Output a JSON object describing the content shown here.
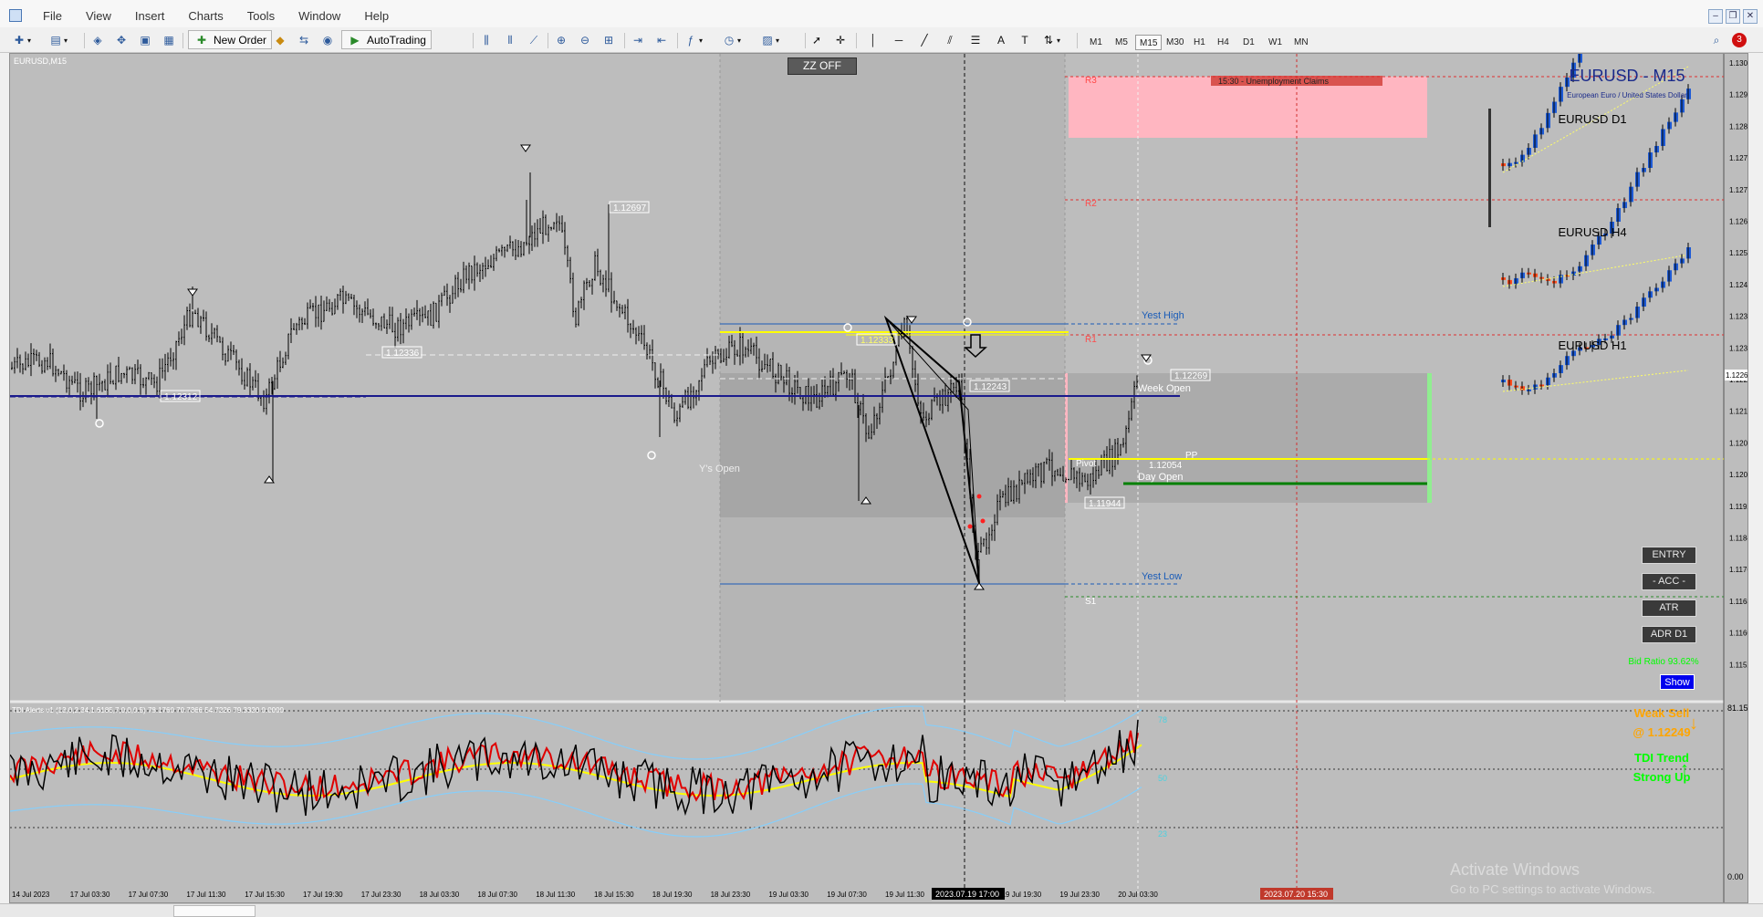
{
  "menu": {
    "items": [
      "File",
      "View",
      "Insert",
      "Charts",
      "Tools",
      "Window",
      "Help"
    ]
  },
  "toolbar": {
    "new_order_label": "New Order",
    "autotrading_label": "AutoTrading",
    "timeframes": [
      "M1",
      "M5",
      "M15",
      "M30",
      "H1",
      "H4",
      "D1",
      "W1",
      "MN"
    ],
    "active_timeframe": "M15",
    "notification_count": "3"
  },
  "chart": {
    "symbol_label": "EURUSD,M15",
    "title": "EURUSD - M15",
    "subtitle": "European Euro / United States Dollar",
    "zz_button": "ZZ OFF",
    "news_label": "15:30 - Unemployment Claims",
    "pivot_labels": {
      "r3": "R3",
      "r2": "R2",
      "r1": "R1",
      "s1": "S1",
      "pp": "PP",
      "pivot": "Pivot"
    },
    "level_labels": {
      "yest_high": "Yest High",
      "yest_low": "Yest Low",
      "week_open": "Week Open",
      "day_open": "Day Open",
      "ys_open": "Y's Open"
    },
    "price_labels": {
      "hi1": "1.12697",
      "p2": "1.12336",
      "p3": "1.12243",
      "p4": "1.12269",
      "p5": "1.12054",
      "p6": "1.11944",
      "p7": "1.12333",
      "p8": "1.12312"
    },
    "mini_titles": [
      "EURUSD D1",
      "EURUSD H4",
      "EURUSD H1"
    ],
    "side_buttons": [
      "ENTRY",
      "- ACC -",
      "ATR",
      "ADR D1"
    ],
    "bid_ratio": "Bid Ratio 93.62%",
    "show_button": "Show",
    "price_axis": [
      "1.13020",
      "1.12945",
      "1.12865",
      "1.12785",
      "1.12710",
      "1.12630",
      "1.12555",
      "1.12475",
      "1.12395",
      "1.12315",
      "1.12269",
      "1.12235",
      "1.12160",
      "1.12080",
      "1.12000",
      "1.11925",
      "1.11845",
      "1.11765",
      "1.11685",
      "1.11605",
      "1.11525",
      "1.11445"
    ],
    "current_price": "1.12269",
    "time_axis": [
      "14 Jul 2023",
      "17 Jul 03:30",
      "17 Jul 07:30",
      "17 Jul 11:30",
      "17 Jul 15:30",
      "17 Jul 19:30",
      "17 Jul 23:30",
      "18 Jul 03:30",
      "18 Jul 07:30",
      "18 Jul 11:30",
      "18 Jul 15:30",
      "18 Jul 19:30",
      "18 Jul 23:30",
      "19 Jul 03:30",
      "19 Jul 07:30",
      "19 Jul 11:30",
      "19 Jul 15:30",
      "19 Jul 19:30",
      "19 Jul 23:30",
      "20 Jul 03:30"
    ],
    "crosshair_time": "2023.07.19 17:00",
    "event_time": "2023.07.20 15:30"
  },
  "indicator": {
    "label": "TDI Alerts v1 (13,0,2,34,1.6185,7,0,0,0.5) 78.1760 70.7366 54.7226 79.3320 0.0000",
    "axis": [
      "81.1524",
      "78",
      "50",
      "23"
    ],
    "signal1_line1": "Weak Sell",
    "signal1_line2": "@ 1.12249",
    "signal2_line1": "TDI Trend",
    "signal2_line2": "Strong Up",
    "bottom_value": "0.00"
  },
  "watermark": {
    "line1": "Activate Windows",
    "line2": "Go to PC settings to activate Windows."
  },
  "colors": {
    "chart_bg": "#bdbdbd",
    "pink_zone": "#ffb6c1",
    "news_box": "#d9534f",
    "yellow": "#ffff00",
    "navy": "#1a1a8c",
    "red": "#e00000",
    "green": "#00a000",
    "orange": "#ffa500",
    "signal_green": "#00ff00",
    "blue_candle": "#1e5bd6",
    "red_candle": "#ff4a1a",
    "light_blue": "#87cefa"
  }
}
